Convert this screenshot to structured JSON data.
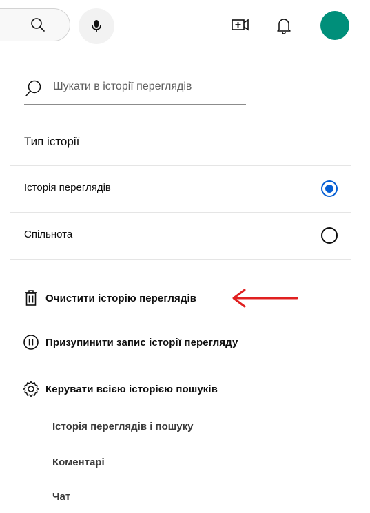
{
  "header": {
    "search_icon": "search-icon",
    "mic_icon": "microphone-icon",
    "create_icon": "video-plus-icon",
    "bell_icon": "bell-icon",
    "avatar_color": "#008f7a"
  },
  "history_search": {
    "placeholder": "Шукати в історії переглядів"
  },
  "history_type": {
    "title": "Тип історії",
    "options": [
      {
        "label": "Історія переглядів",
        "selected": true
      },
      {
        "label": "Спільнота",
        "selected": false
      }
    ]
  },
  "actions": {
    "clear": "Очистити історію переглядів",
    "pause": "Призупинити запис історії перегляду",
    "manage": "Керувати всією історією пошуків"
  },
  "sub_links": [
    "Історія переглядів і пошуку",
    "Коментарі",
    "Чат"
  ],
  "colors": {
    "accent": "#065fd4",
    "annotation_arrow": "#e02020"
  }
}
